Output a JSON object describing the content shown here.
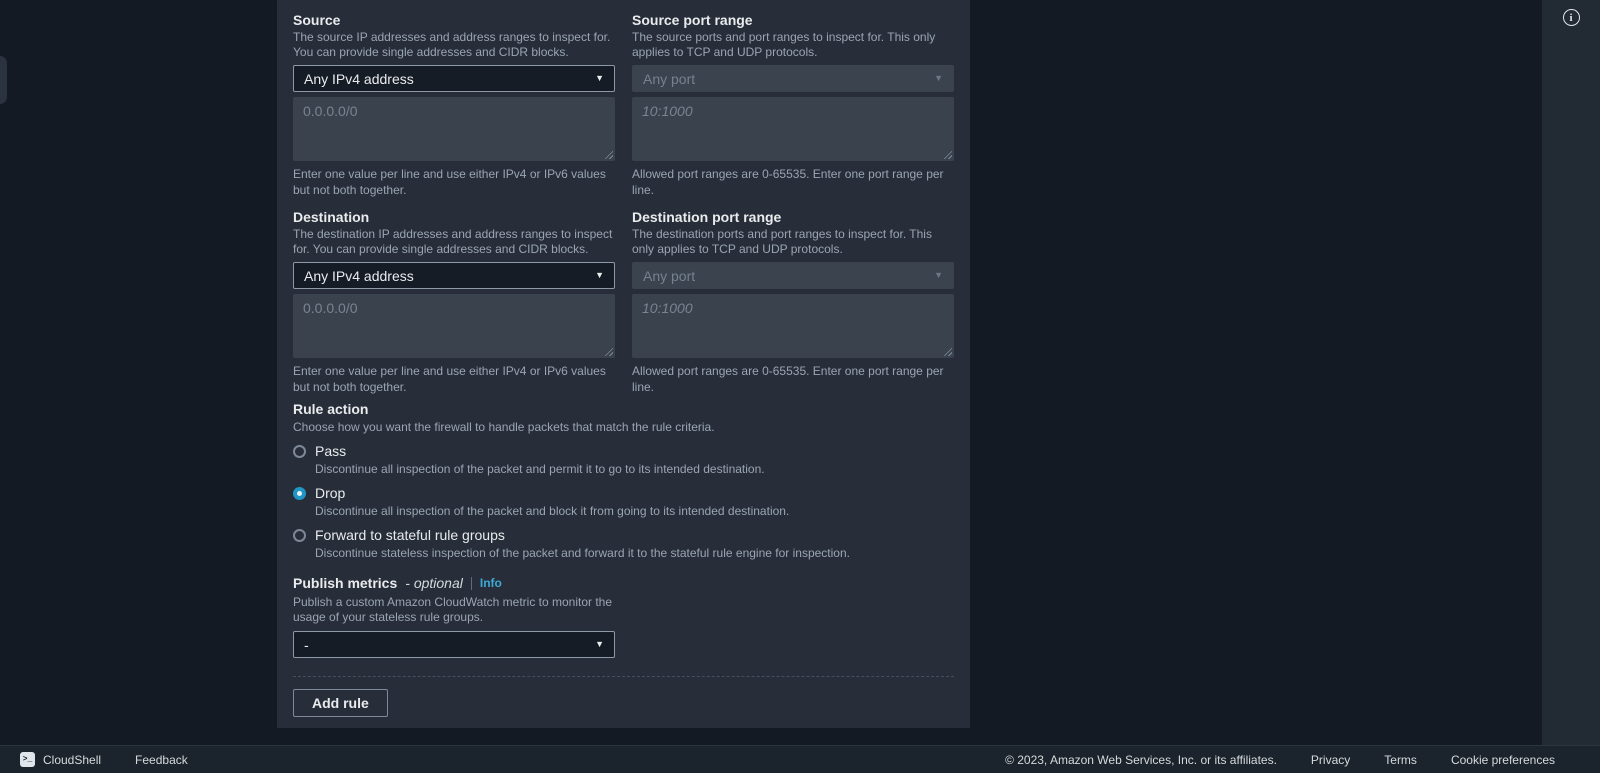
{
  "colors": {
    "container_bg": "#272e39",
    "page_bg": "#141a23",
    "accent_link": "#3fa9d5",
    "radio_selected": "#2196c4",
    "disabled_field_bg": "#3a424e"
  },
  "icons": {
    "dropdown_caret": "▼",
    "info": "i",
    "cloudshell_terminal": ">_"
  },
  "panel": {
    "fields": {
      "source": {
        "label": "Source",
        "description": "The source IP addresses and address ranges to inspect for. You can provide single addresses and CIDR blocks.",
        "dropdown_value": "Any IPv4 address",
        "textarea_placeholder": "0.0.0.0/0",
        "helper": "Enter one value per line and use either IPv4 or IPv6 values but not both together."
      },
      "source_port": {
        "label": "Source port range",
        "description": "The source ports and port ranges to inspect for. This only applies to TCP and UDP protocols.",
        "dropdown_value": "Any port",
        "textarea_placeholder": "10:1000",
        "helper": "Allowed port ranges are 0-65535. Enter one port range per line."
      },
      "destination": {
        "label": "Destination",
        "description": "The destination IP addresses and address ranges to inspect for. You can provide single addresses and CIDR blocks.",
        "dropdown_value": "Any IPv4 address",
        "textarea_placeholder": "0.0.0.0/0",
        "helper": "Enter one value per line and use either IPv4 or IPv6 values but not both together."
      },
      "destination_port": {
        "label": "Destination port range",
        "description": "The destination ports and port ranges to inspect for. This only applies to TCP and UDP protocols.",
        "dropdown_value": "Any port",
        "textarea_placeholder": "10:1000",
        "helper": "Allowed port ranges are 0-65535. Enter one port range per line."
      }
    },
    "rule_action": {
      "label": "Rule action",
      "description": "Choose how you want the firewall to handle packets that match the rule criteria.",
      "options": [
        {
          "label": "Pass",
          "description": "Discontinue all inspection of the packet and permit it to go to its intended destination.",
          "selected": false
        },
        {
          "label": "Drop",
          "description": "Discontinue all inspection of the packet and block it from going to its intended destination.",
          "selected": true
        },
        {
          "label": "Forward to stateful rule groups",
          "description": "Discontinue stateless inspection of the packet and forward it to the stateful rule engine for inspection.",
          "selected": false
        }
      ]
    },
    "publish_metrics": {
      "label": "Publish metrics",
      "optional_suffix": "- optional",
      "info_link": "Info",
      "description": "Publish a custom Amazon CloudWatch metric to monitor the usage of your stateless rule groups.",
      "dropdown_value": "-"
    },
    "add_rule_button": "Add rule"
  },
  "footer": {
    "cloudshell": "CloudShell",
    "feedback": "Feedback",
    "copyright": "© 2023, Amazon Web Services, Inc. or its affiliates.",
    "links": [
      "Privacy",
      "Terms",
      "Cookie preferences"
    ]
  }
}
